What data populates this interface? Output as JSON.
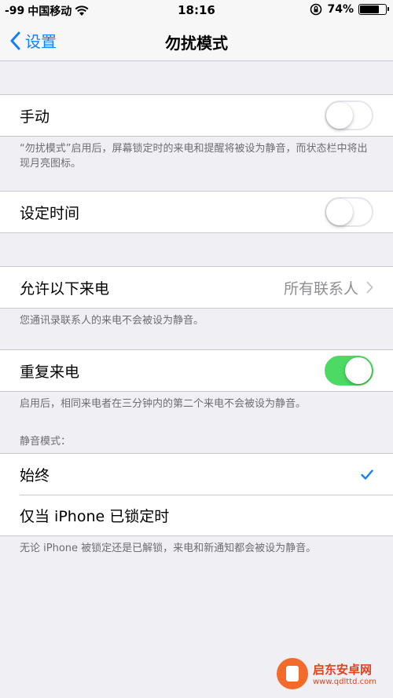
{
  "status_bar": {
    "signal": "-99",
    "carrier": "中国移动",
    "time": "18:16",
    "battery": "74%",
    "battery_level": 0.74
  },
  "nav": {
    "back_label": "设置",
    "title": "勿扰模式"
  },
  "manual": {
    "label": "手动",
    "toggle_on": false,
    "footer": "“勿扰模式”启用后，屏幕锁定时的来电和提醒将被设为静音，而状态栏中将出现月亮图标。"
  },
  "scheduled": {
    "label": "设定时间",
    "toggle_on": false
  },
  "allow_calls": {
    "label": "允许以下来电",
    "value": "所有联系人",
    "footer": "您通讯录联系人的来电不会被设为静音。"
  },
  "repeated": {
    "label": "重复来电",
    "toggle_on": true,
    "footer": "启用后，相同来电者在三分钟内的第二个来电不会被设为静音。"
  },
  "silence": {
    "header": "静音模式：",
    "options": [
      {
        "label": "始终",
        "selected": true
      },
      {
        "label": "仅当 iPhone 已锁定时",
        "selected": false
      }
    ],
    "footer": "无论 iPhone 被锁定还是已解锁，来电和新通知都会被设为静音。"
  },
  "watermark": {
    "name": "启东安卓网",
    "url": "www.qdlttd.com"
  },
  "colors": {
    "accent": "#157efb",
    "toggle_on": "#4cd964",
    "background": "#efeff4"
  }
}
